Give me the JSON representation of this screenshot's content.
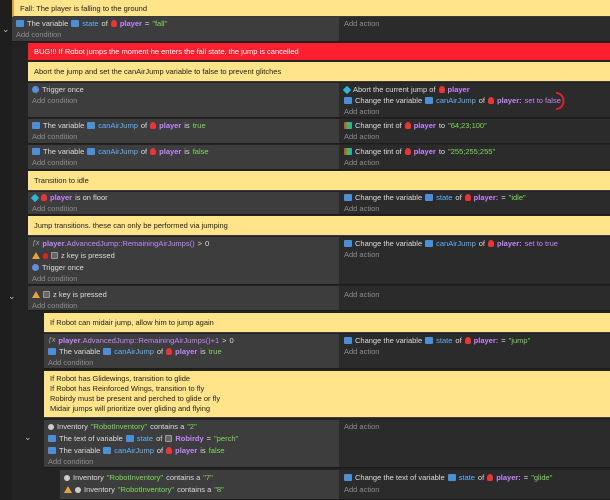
{
  "header": {
    "title": "Fall: The player is falling to the ground"
  },
  "add_condition": "Add condition",
  "add_action": "Add action",
  "ev_fall": {
    "t1": "The variable",
    "v": "state",
    "of": "of",
    "obj": "player",
    "eq": "=",
    "val": "\"fall\""
  },
  "bug_banner": "BUG!!! If Robot jumps the moment he enters the fall state, the jump is cancelled",
  "comment_abort": "Abort the jump and set the canAirJump variable to false to prevent glitches",
  "ev_trigger": {
    "cond": "Trigger once",
    "a1": "Abort the current jump of",
    "a1_obj": "player",
    "a2": "Change the variable",
    "a2_var": "canAirJump",
    "a2_of": "of",
    "a2_obj": "player:",
    "a2_val": "set to false"
  },
  "ev_tint_true": {
    "t1": "The variable",
    "v": "canAirJump",
    "of": "of",
    "obj": "player",
    "is": "is",
    "val": "true",
    "act": "Change tint of",
    "act_obj": "player",
    "act_to": "to",
    "act_val": "\"64;23;100\""
  },
  "ev_tint_false": {
    "t1": "The variable",
    "v": "canAirJump",
    "of": "of",
    "obj": "player",
    "is": "is",
    "val": "false",
    "act": "Change tint of",
    "act_obj": "player",
    "act_to": "to",
    "act_val": "\"255;255;255\""
  },
  "comment_idle": "Transition to idle",
  "ev_floor": {
    "obj": "player",
    "cond": "is on floor",
    "act": "Change the variable",
    "act_var": "state",
    "act_of": "of",
    "act_obj": "player:",
    "act_eq": "=",
    "act_val": "\"idle\""
  },
  "comment_jump": "Jump transitions. these can only be performed via jumping",
  "ev_airjumps": {
    "c1_obj": "player",
    "c1_expr": ".AdvancedJump::RemainingAirJumps()",
    "c1_op": ">",
    "c1_val": "0",
    "c2": "z key is pressed",
    "c3": "Trigger once",
    "act": "Change the variable",
    "act_var": "canAirJump",
    "act_of": "of",
    "act_obj": "player:",
    "act_val": "set to true"
  },
  "ev_zkey": {
    "cond": "z key is pressed"
  },
  "comment_midair": "If Robot can midair jump, allow him to jump again",
  "ev_midair": {
    "c1_obj": "player",
    "c1_expr": ".AdvancedJump::RemainingAirJumps()+1",
    "c1_op": ">",
    "c1_val": "0",
    "c2": "The variable",
    "c2_var": "canAirJump",
    "c2_of": "of",
    "c2_obj": "player",
    "c2_is": "is",
    "c2_val": "true",
    "act": "Change the variable",
    "act_var": "state",
    "act_of": "of",
    "act_obj": "player:",
    "act_eq": "=",
    "act_val": "\"jump\""
  },
  "comment_glide": [
    "If Robot has Glidewings, transition to glide",
    "If Robot has Reinforced Wings, transition to fly",
    "Robirdy must be present and perched to glide or fly",
    "Midair jumps will prioritize over gliding and flying"
  ],
  "ev_inv2": {
    "c1": "Inventory",
    "c1_name": "\"RobotInventory\"",
    "c1_contains": "contains a",
    "c1_val": "\"2\"",
    "c2": "The text of variable",
    "c2_var": "state",
    "c2_of": "of",
    "c2_obj": "Robirdy",
    "c2_eq": "=",
    "c2_val": "\"perch\"",
    "c3": "The variable",
    "c3_var": "canAirJump",
    "c3_of": "of",
    "c3_obj": "player",
    "c3_is": "is",
    "c3_val": "false"
  },
  "ev_inv7": {
    "c1": "Inventory",
    "c1_name": "\"RobotInventory\"",
    "c1_contains": "contains a",
    "c1_val": "\"7\"",
    "c2": "Inventory",
    "c2_name": "\"RobotInventory\"",
    "c2_contains": "contains a",
    "c2_val": "\"8\"",
    "act": "Change the text of variable",
    "act_var": "state",
    "act_of": "of",
    "act_obj": "player:",
    "act_eq": "=",
    "act_val": "\"glide\""
  }
}
